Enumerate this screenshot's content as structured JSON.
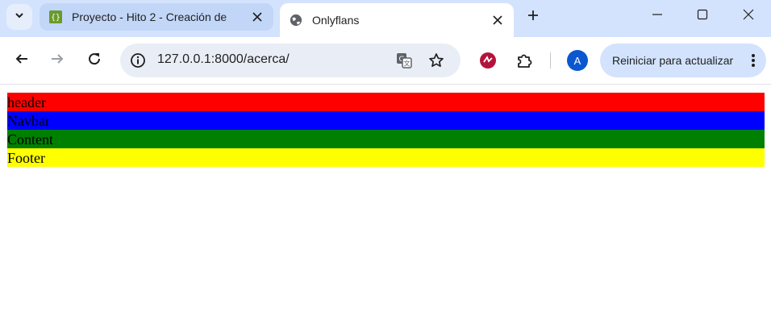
{
  "tabs": [
    {
      "title": "Proyecto - Hito 2 - Creación de",
      "active": false,
      "favicon": "code-braces-icon"
    },
    {
      "title": "Onlyflans",
      "active": true,
      "favicon": "globe-icon"
    }
  ],
  "toolbar": {
    "url": "127.0.0.1:8000/acerca/",
    "update_label": "Reiniciar para actualizar",
    "profile_initial": "A"
  },
  "page": {
    "sections": [
      {
        "label": "header",
        "color": "#ff0000"
      },
      {
        "label": "Navbar",
        "color": "#0000ff"
      },
      {
        "label": "Content",
        "color": "#008000"
      },
      {
        "label": "Footer",
        "color": "#ffff00"
      }
    ]
  },
  "colors": {
    "tabstrip": "#d3e3fd",
    "accent": "#0b57d0"
  }
}
